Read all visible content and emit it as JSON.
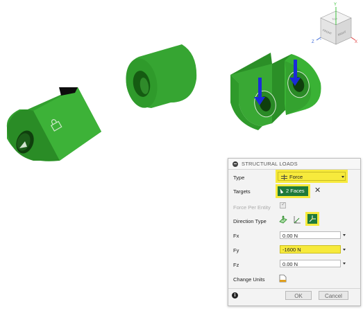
{
  "viewcube": {
    "top_label": "TOP",
    "front_label": "FRONT",
    "right_label": "RIGHT",
    "axis_y": "Y",
    "axis_z": "Z",
    "axis_x": "X"
  },
  "panel": {
    "title": "STRUCTURAL LOADS",
    "type_label": "Type",
    "type_value": "Force",
    "targets_label": "Targets",
    "targets_value": "2 Faces",
    "force_per_entity_label": "Force Per Entity",
    "force_per_entity_checked": true,
    "direction_type_label": "Direction Type",
    "fx_label": "Fx",
    "fx_value": "0.00 N",
    "fy_label": "Fy",
    "fy_value": "-1600 N",
    "fz_label": "Fz",
    "fz_value": "0.00 N",
    "change_units_label": "Change Units",
    "ok_label": "OK",
    "cancel_label": "Cancel"
  },
  "colors": {
    "part_green": "#3aa535",
    "part_dark": "#1f7a1c",
    "highlight": "#f7ea3c",
    "load_arrow": "#1a2bd8"
  }
}
